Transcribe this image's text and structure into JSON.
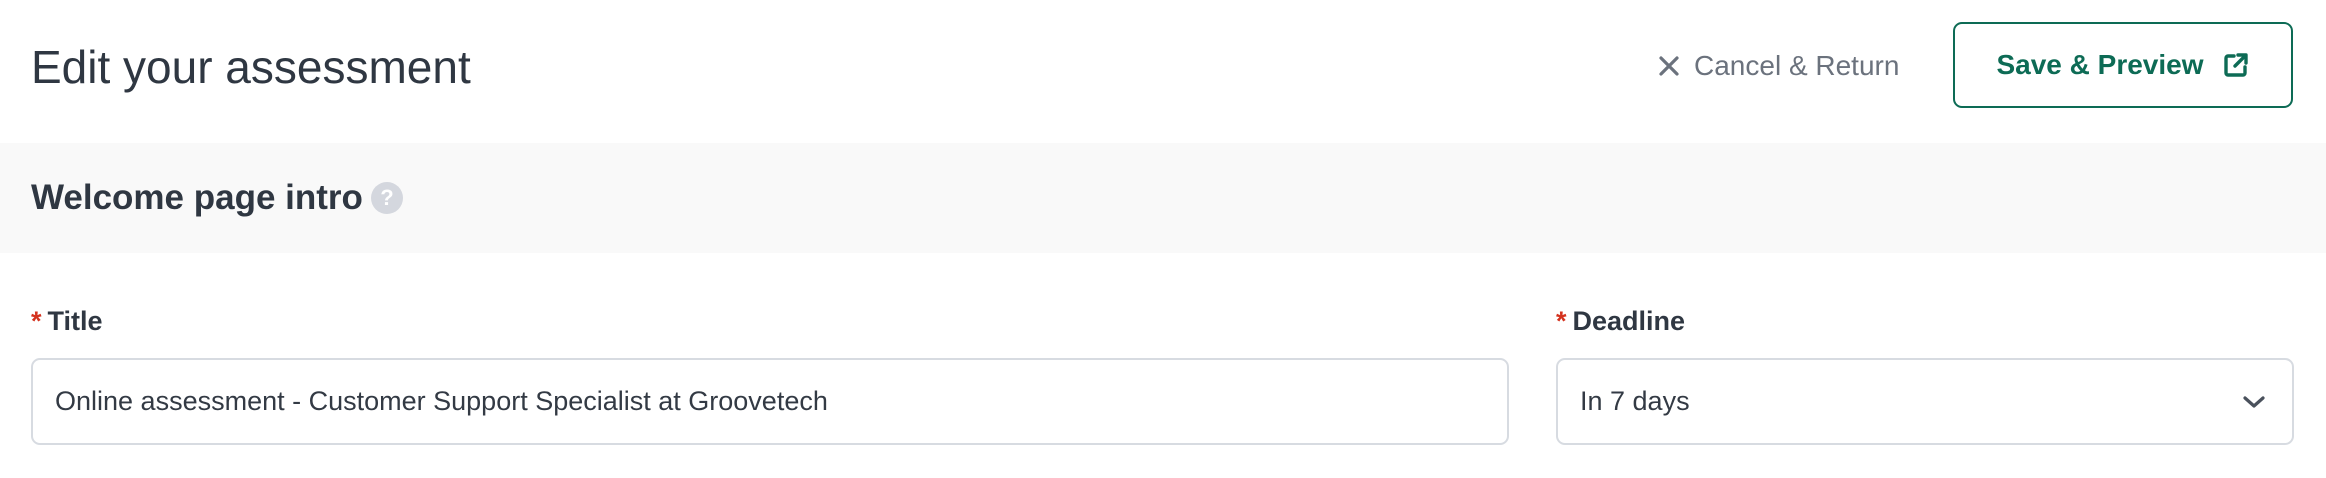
{
  "header": {
    "title": "Edit your assessment",
    "cancel_label": "Cancel & Return",
    "cancel_icon": "close-icon",
    "save_label": "Save & Preview",
    "save_icon": "external-link-icon"
  },
  "section": {
    "title": "Welcome page intro",
    "help_glyph": "?"
  },
  "form": {
    "title_field": {
      "required_mark": "*",
      "label": "Title",
      "value": "Online assessment - Customer Support Specialist at Groovetech"
    },
    "deadline_field": {
      "required_mark": "*",
      "label": "Deadline",
      "selected": "In 7 days"
    }
  },
  "colors": {
    "accent": "#0d6b55",
    "required": "#d4321e",
    "section_background": "#f9f9f9",
    "muted_text": "#6b727d"
  }
}
